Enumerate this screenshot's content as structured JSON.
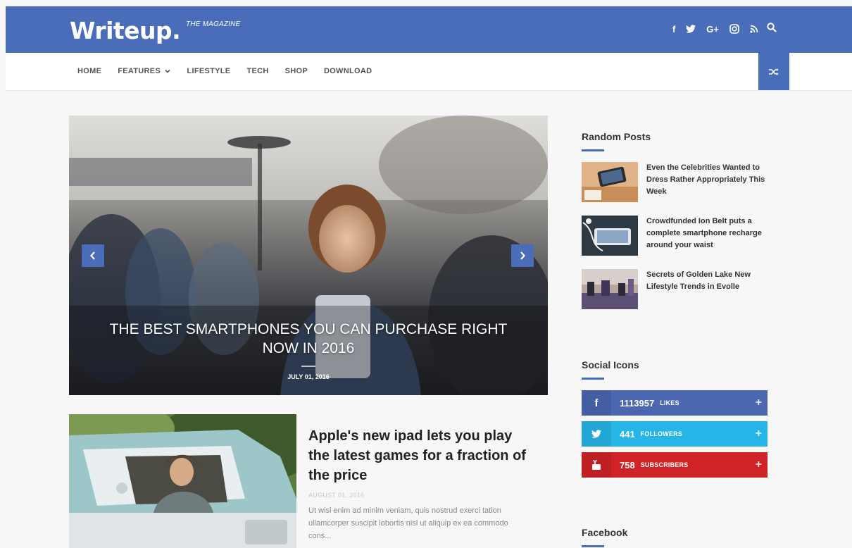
{
  "header": {
    "logo": "Writeup.",
    "tagline": "THE MAGAZINE",
    "social_icons": [
      "facebook-icon",
      "twitter-icon",
      "google-plus-icon",
      "instagram-icon",
      "rss-icon"
    ],
    "social_glyphs": {
      "facebook": "f",
      "google_plus": "G+"
    },
    "brand_color": "#4a6dba"
  },
  "nav": {
    "items": [
      "HOME",
      "FEATURES",
      "LIFESTYLE",
      "TECH",
      "SHOP",
      "DOWNLOAD"
    ]
  },
  "hero": {
    "title": "THE BEST SMARTPHONES YOU CAN PURCHASE RIGHT NOW IN 2016",
    "date": "JULY 01, 2016"
  },
  "post": {
    "title": "Apple's new ipad lets you play the latest games for a fraction of the price",
    "date": "AUGUST 01, 2016",
    "excerpt": "Ut wisi enim ad minim veniam, quis nostrud exerci tation ullamcorper suscipit lobortis nisl ut aliquip ex ea commodo cons..."
  },
  "sidebar": {
    "random_posts_title": "Random Posts",
    "random_posts": [
      {
        "title": "Even the Celebrities Wanted to Dress Rather Appropriately This Week"
      },
      {
        "title": "Crowdfunded Ion Belt puts a complete smartphone recharge around your waist"
      },
      {
        "title": "Secrets of Golden Lake New Lifestyle Trends in Evolle"
      }
    ],
    "social_icons_title": "Social Icons",
    "social_counts": [
      {
        "network": "facebook",
        "count": "1113957",
        "label": "LIKES",
        "color": "#4a67b0"
      },
      {
        "network": "twitter",
        "count": "441",
        "label": "FOLLOWERS",
        "color": "#25b5e6"
      },
      {
        "network": "youtube",
        "count": "758",
        "label": "SUBSCRIBERS",
        "color": "#cf2327"
      }
    ],
    "facebook_title": "Facebook"
  }
}
